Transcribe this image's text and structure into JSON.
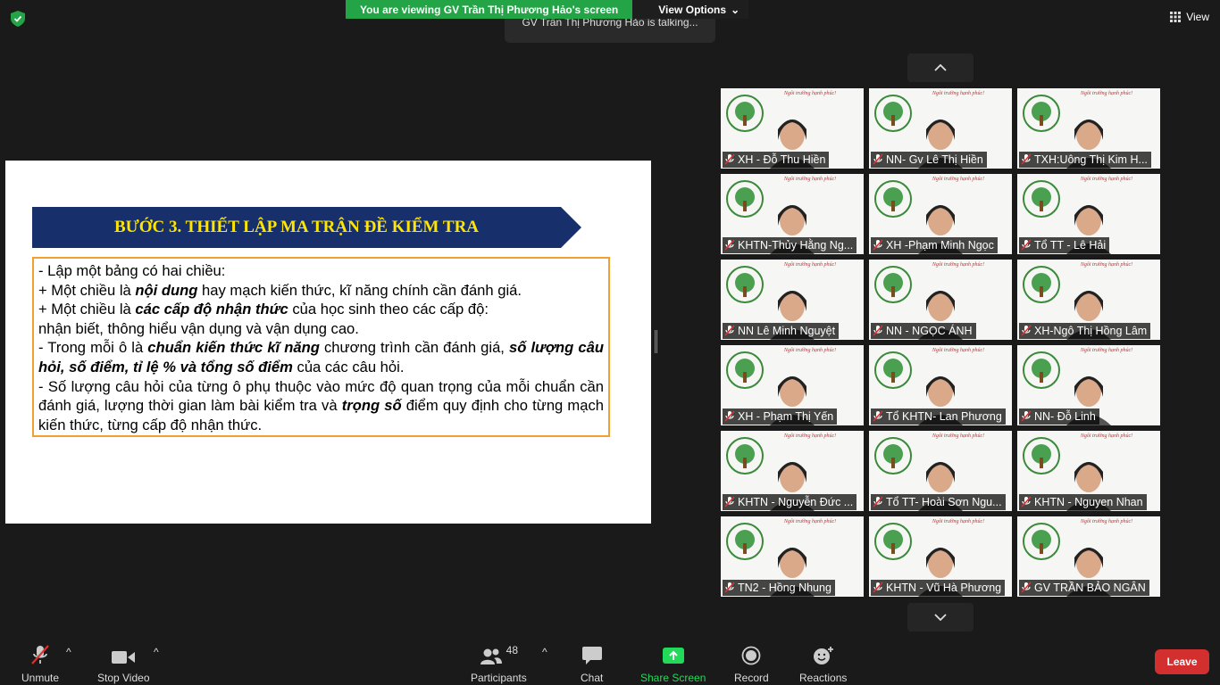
{
  "top": {
    "banner_text": "You are viewing GV Trần Thị Phương Hảo's screen",
    "view_options": "View Options",
    "talking": "GV Trần Thị Phương Hảo is talking...",
    "view_label": "View"
  },
  "slide": {
    "title": "BƯỚC 3.  THIẾT LẬP MA TRẬN ĐỀ KIỂM TRA",
    "l1": "- Lập một bảng có hai chiều:",
    "l2a": "+ Một chiều là ",
    "l2b": "nội dung",
    "l2c": " hay mạch kiến thức, kĩ năng chính cần đánh giá.",
    "l3a": "+ Một chiều là ",
    "l3b": "các cấp độ nhận thức",
    "l3c": " của học sinh theo các cấp độ:",
    "l4": " nhận biết, thông hiểu vận dụng và vận dụng cao.",
    "l5a": "- Trong mỗi ô là ",
    "l5b": "chuẩn kiến thức kĩ năng",
    "l5c": " chương trình cần đánh giá, ",
    "l5d": "số lượng câu hỏi, số điểm, tỉ lệ % và tổng số điểm",
    "l5e": " của các câu hỏi.",
    "l6a": "- Số lượng câu hỏi của từng ô phụ thuộc vào mức độ quan trọng của mỗi chuẩn cần đánh giá, lượng thời gian làm bài kiểm tra và ",
    "l6b": "trọng số",
    "l6c": " điểm quy định cho từng mạch kiến thức, từng cấp độ nhận thức."
  },
  "tiles": [
    {
      "name": "XH - Đỗ Thu Hiền"
    },
    {
      "name": "NN- Gv Lê Thị Hiền"
    },
    {
      "name": "TXH:Uông Thị Kim H..."
    },
    {
      "name": "KHTN-Thủy Hằng Ng..."
    },
    {
      "name": "XH -Phạm Minh Ngọc"
    },
    {
      "name": "Tổ TT - Lê Hải"
    },
    {
      "name": "NN Lê Minh Nguyệt"
    },
    {
      "name": "NN - NGỌC ÁNH"
    },
    {
      "name": "XH-Ngô Thị Hồng Lâm"
    },
    {
      "name": "XH - Phạm Thị Yến"
    },
    {
      "name": "Tổ KHTN- Lan Phương"
    },
    {
      "name": "NN- Đỗ Linh"
    },
    {
      "name": "KHTN - Nguyễn Đức ..."
    },
    {
      "name": "Tổ TT- Hoài Sơn Ngu..."
    },
    {
      "name": "KHTN - Nguyen Nhan"
    },
    {
      "name": "TN2 - Hồng Nhung"
    },
    {
      "name": "KHTN - Vũ Hà Phương"
    },
    {
      "name": "GV TRẦN BẢO NGÂN"
    }
  ],
  "toolbar": {
    "unmute": "Unmute",
    "stop_video": "Stop Video",
    "participants": "Participants",
    "participant_count": "48",
    "chat": "Chat",
    "share_screen": "Share Screen",
    "record": "Record",
    "reactions": "Reactions",
    "leave": "Leave"
  },
  "colors": {
    "banner_green": "#23a547",
    "share_green": "#23d959",
    "leave_red": "#d32f2f",
    "slide_navy": "#17306b",
    "slide_title_yellow": "#ffe500"
  }
}
